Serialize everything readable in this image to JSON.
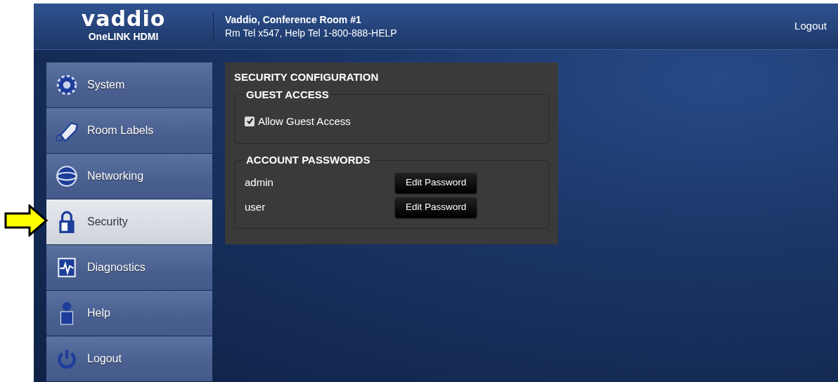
{
  "header": {
    "logo": "vaddio",
    "product": "OneLINK HDMI",
    "room_title": "Vaddio, Conference Room #1",
    "room_phone": "Rm Tel x547, Help Tel 1-800-888-HELP",
    "logout": "Logout"
  },
  "sidebar": {
    "items": [
      {
        "label": "System",
        "selected": false
      },
      {
        "label": "Room Labels",
        "selected": false
      },
      {
        "label": "Networking",
        "selected": false
      },
      {
        "label": "Security",
        "selected": true
      },
      {
        "label": "Diagnostics",
        "selected": false
      },
      {
        "label": "Help",
        "selected": false
      },
      {
        "label": "Logout",
        "selected": false
      }
    ]
  },
  "panel": {
    "title": "SECURITY CONFIGURATION",
    "guest_access": {
      "legend": "GUEST ACCESS",
      "checkbox": {
        "label": "Allow Guest Access",
        "checked": true
      }
    },
    "account_passwords": {
      "legend": "ACCOUNT PASSWORDS",
      "accounts": [
        {
          "name": "admin",
          "button": "Edit Password"
        },
        {
          "name": "user",
          "button": "Edit Password"
        }
      ]
    }
  }
}
